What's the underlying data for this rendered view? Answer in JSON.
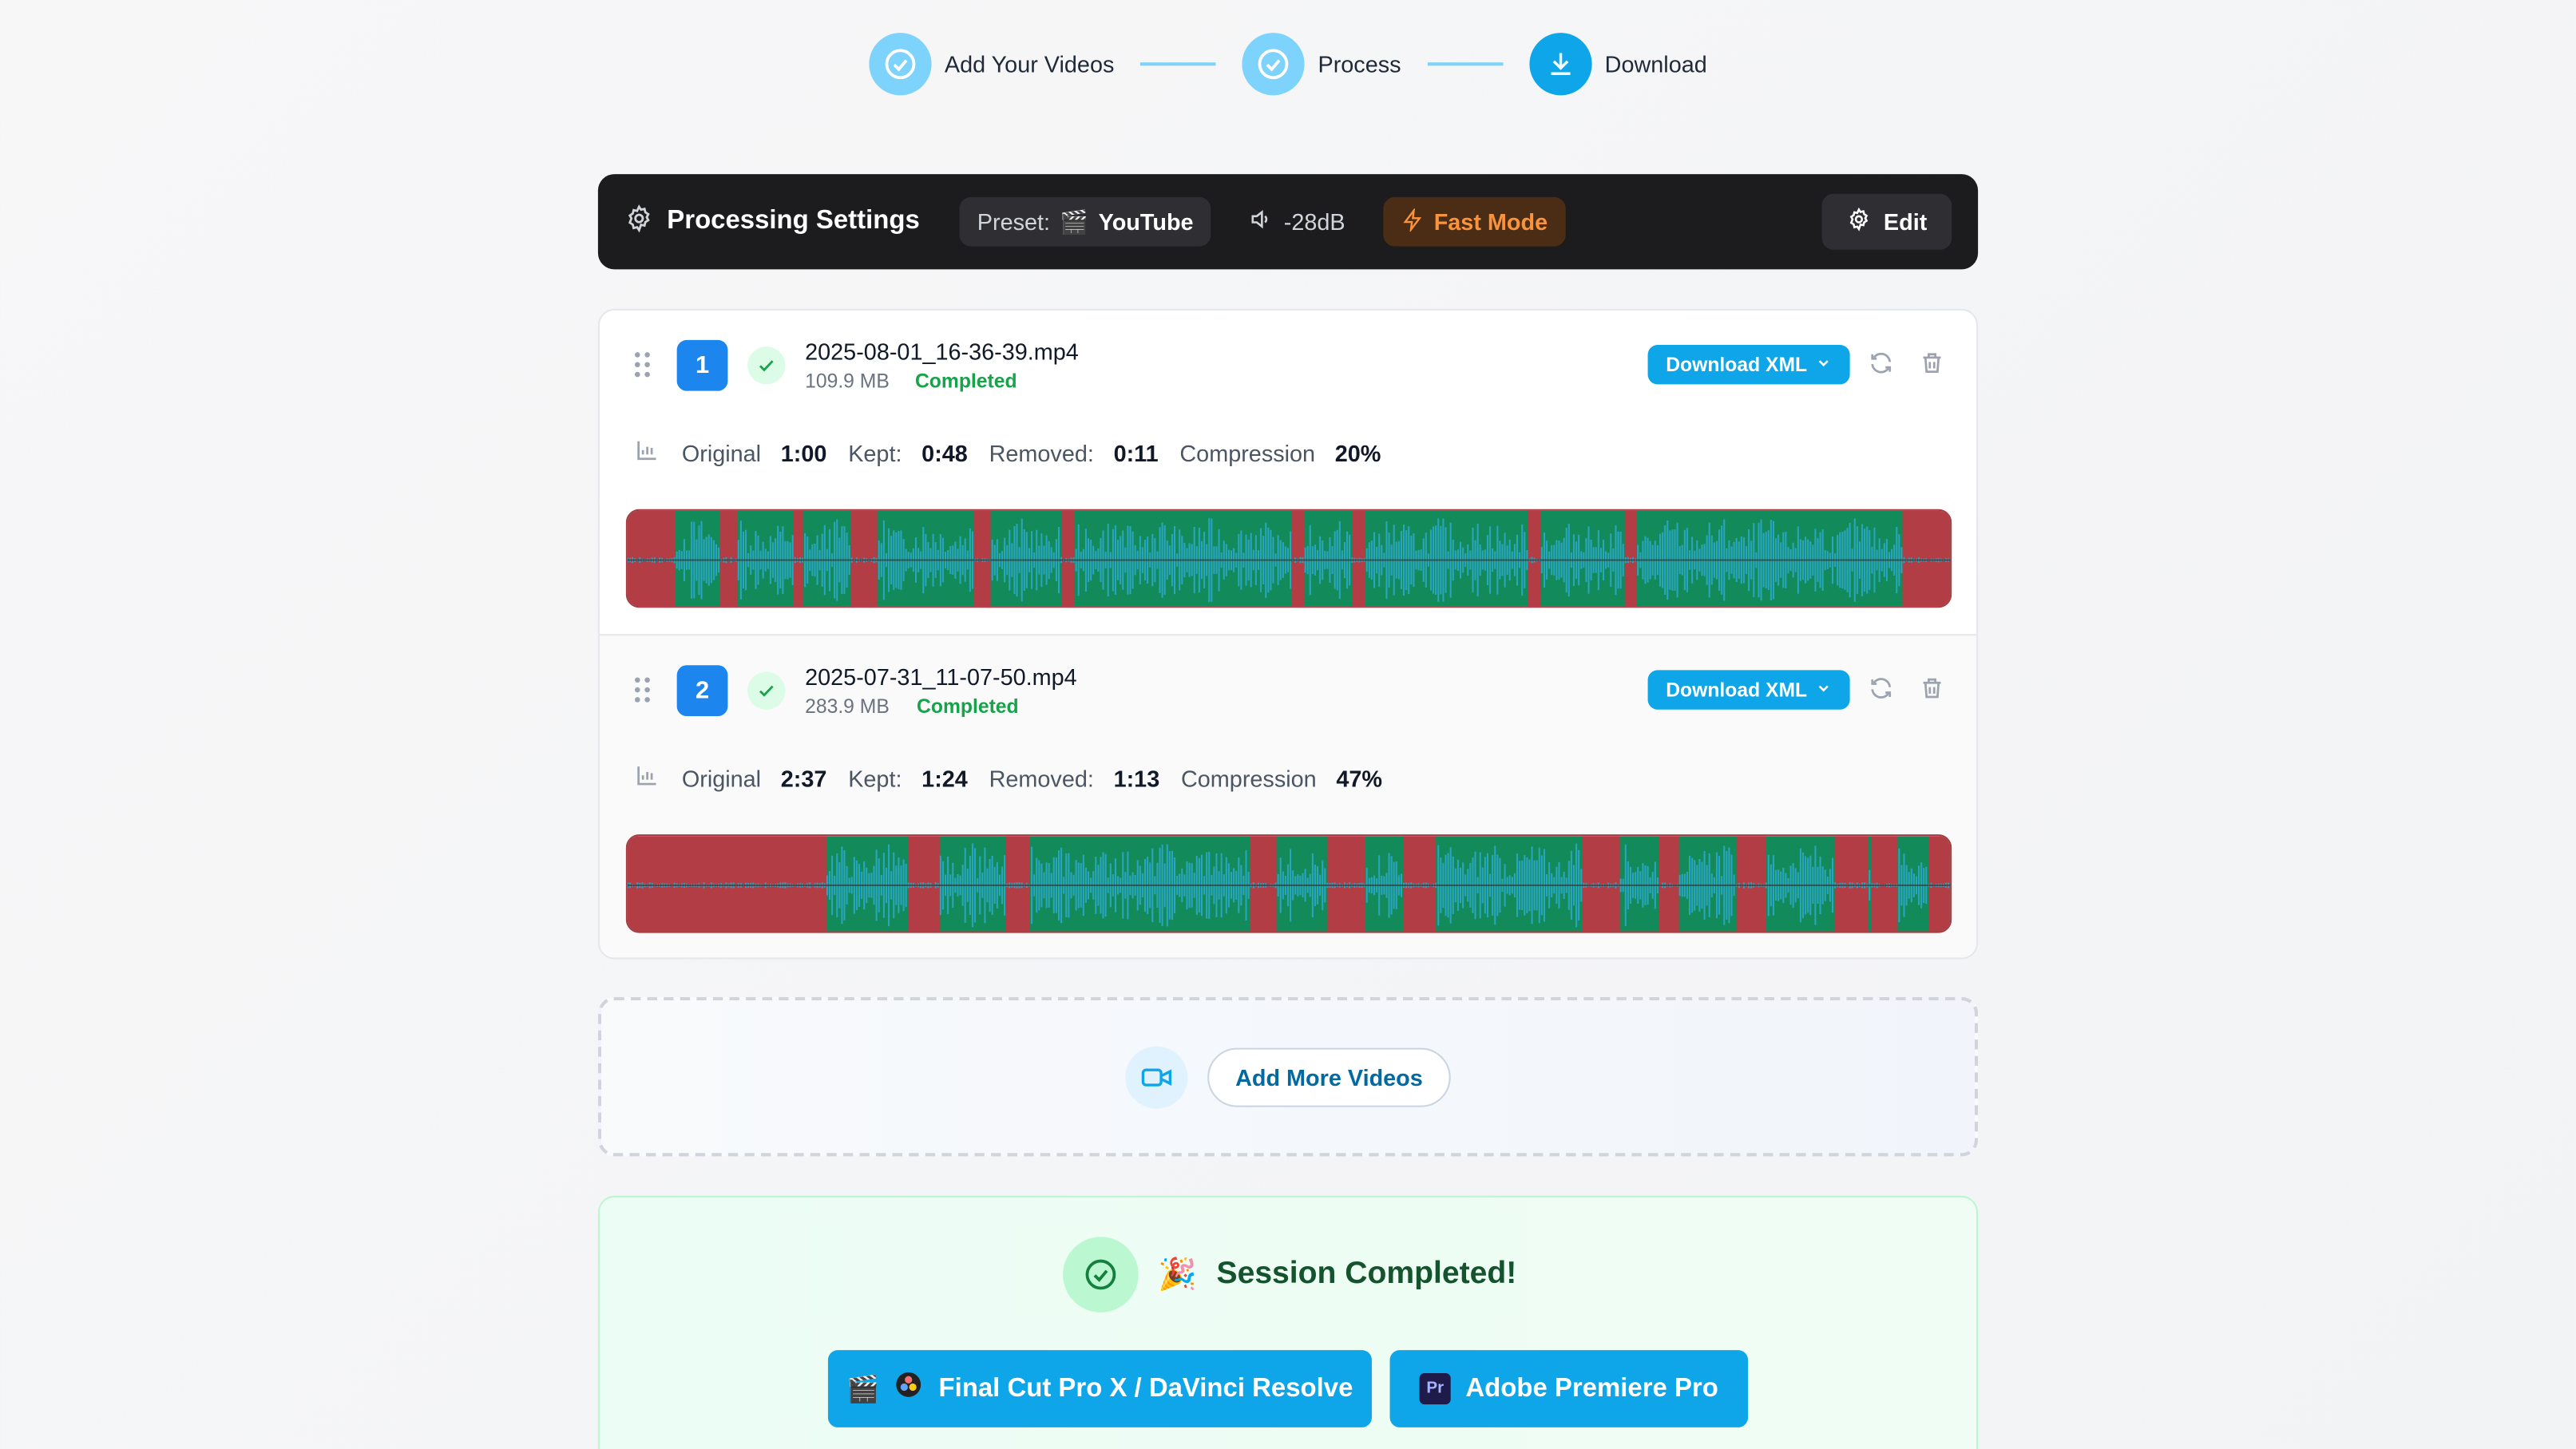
{
  "steps": [
    {
      "label": "Add Your Videos",
      "state": "done",
      "icon": "check-circle-icon"
    },
    {
      "label": "Process",
      "state": "done",
      "icon": "check-circle-icon"
    },
    {
      "label": "Download",
      "state": "active",
      "icon": "download-icon"
    }
  ],
  "settings": {
    "title": "Processing Settings",
    "preset_label": "Preset:",
    "preset_emoji": "🎬",
    "preset_value": "YouTube",
    "threshold": "-28dB",
    "mode": "Fast Mode",
    "edit_label": "Edit"
  },
  "videos": [
    {
      "index": "1",
      "filename": "2025-08-01_16-36-39.mp4",
      "size": "109.9 MB",
      "status": "Completed",
      "download_label": "Download XML",
      "stats": {
        "original_label": "Original",
        "original": "1:00",
        "kept_label": "Kept:",
        "kept": "0:48",
        "removed_label": "Removed:",
        "removed": "0:11",
        "compression_label": "Compression",
        "compression": "20%"
      }
    },
    {
      "index": "2",
      "filename": "2025-07-31_11-07-50.mp4",
      "size": "283.9 MB",
      "status": "Completed",
      "download_label": "Download XML",
      "stats": {
        "original_label": "Original",
        "original": "2:37",
        "kept_label": "Kept:",
        "kept": "1:24",
        "removed_label": "Removed:",
        "removed": "1:13",
        "compression_label": "Compression",
        "compression": "47%"
      }
    }
  ],
  "add_more": {
    "label": "Add More Videos"
  },
  "session": {
    "emoji": "🎉",
    "title": "Session Completed!",
    "export_fcp_emoji": "🎬",
    "export_fcp": "Final Cut Pro X / DaVinci Resolve",
    "export_premiere_badge": "Pr",
    "export_premiere": "Adobe Premiere Pro"
  },
  "colors": {
    "accent": "#0ea5e9",
    "kept_segment": "#138a5a",
    "removed_segment": "#b23d45",
    "waveform": "#2ba6c5",
    "completed": "#16a34a",
    "fast_mode": "#fb923c"
  }
}
